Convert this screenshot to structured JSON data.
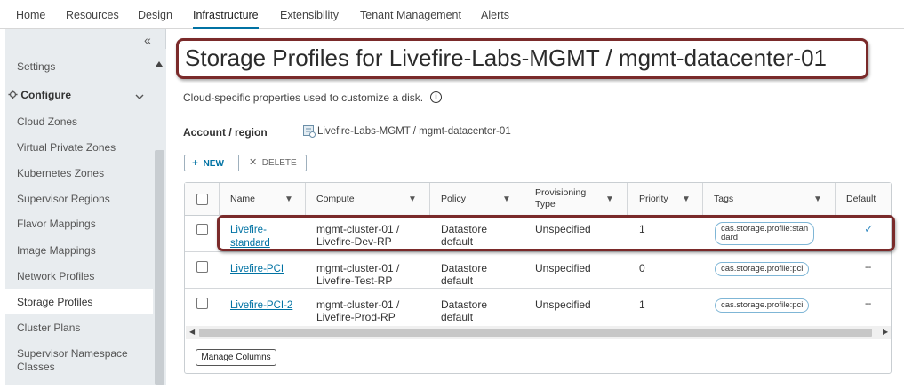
{
  "top_nav": {
    "tabs": [
      "Home",
      "Resources",
      "Design",
      "Infrastructure",
      "Extensibility",
      "Tenant Management",
      "Alerts"
    ],
    "active": "Infrastructure"
  },
  "sidebar": {
    "collapse_glyph": "«",
    "settings_label": "Settings",
    "configure_label": "Configure",
    "items": [
      "Cloud Zones",
      "Virtual Private Zones",
      "Kubernetes Zones",
      "Supervisor Regions",
      "Flavor Mappings",
      "Image Mappings",
      "Network Profiles",
      "Storage Profiles",
      "Cluster Plans",
      "Supervisor Namespace",
      "Classes"
    ],
    "selected": "Storage Profiles"
  },
  "page": {
    "title": "Storage Profiles for Livefire-Labs-MGMT / mgmt-datacenter-01",
    "description": "Cloud-specific properties used to customize a disk.",
    "account_label": "Account / region",
    "account_value": "Livefire-Labs-MGMT / mgmt-datacenter-01"
  },
  "toolbar": {
    "new_label": "NEW",
    "delete_label": "DELETE"
  },
  "grid": {
    "columns": [
      "Name",
      "Compute",
      "Policy",
      "Provisioning",
      "Type",
      "Priority",
      "Tags",
      "Default"
    ],
    "rows": [
      {
        "name_line1": "Livefire-",
        "name_line2": "standard",
        "compute_line1": "mgmt-cluster-01 /",
        "compute_line2": "Livefire-Dev-RP",
        "policy_line1": "Datastore",
        "policy_line2": "default",
        "provisioning": "Unspecified",
        "priority": "1",
        "tag_line1": "cas.storage.profile:stan",
        "tag_line2": "dard",
        "default": "✓"
      },
      {
        "name_line1": "Livefire-PCI",
        "name_line2": "",
        "compute_line1": "mgmt-cluster-01 /",
        "compute_line2": "Livefire-Test-RP",
        "policy_line1": "Datastore",
        "policy_line2": "default",
        "provisioning": "Unspecified",
        "priority": "0",
        "tag_line1": "cas.storage.profile:pci",
        "tag_line2": "",
        "default": "--"
      },
      {
        "name_line1": "Livefire-PCI-2",
        "name_line2": "",
        "compute_line1": "mgmt-cluster-01 /",
        "compute_line2": "Livefire-Prod-RP",
        "policy_line1": "Datastore",
        "policy_line2": "default",
        "provisioning": "Unspecified",
        "priority": "1",
        "tag_line1": "cas.storage.profile:pci",
        "tag_line2": "",
        "default": "--"
      }
    ],
    "manage_columns_label": "Manage Columns"
  },
  "colors": {
    "accent": "#0072a3",
    "highlight_border": "#7a2a2a",
    "sidebar_bg": "#e8ecef"
  }
}
